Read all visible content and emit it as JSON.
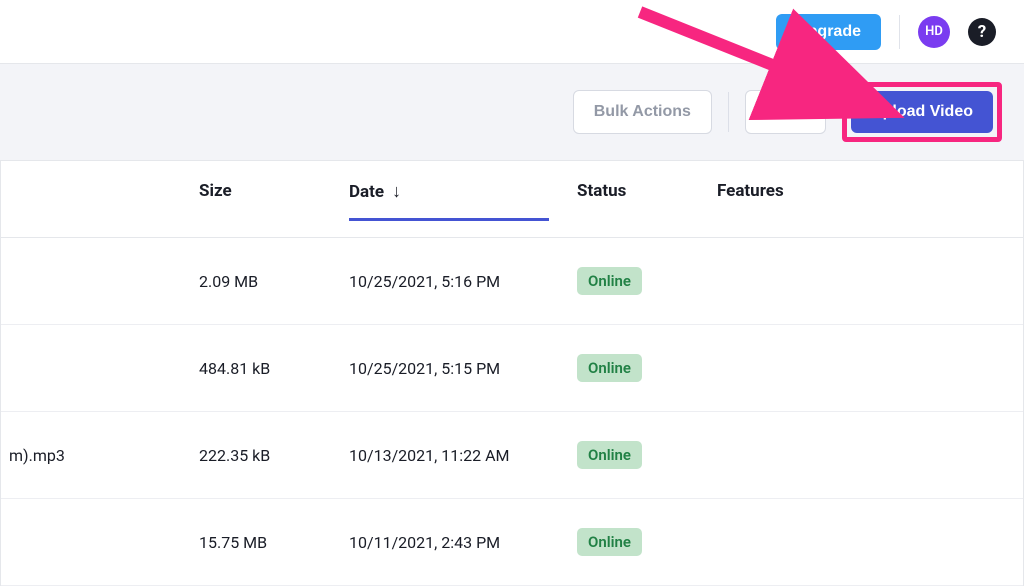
{
  "topbar": {
    "upgrade_label": "Upgrade",
    "avatar_initials": "HD",
    "help_glyph": "?"
  },
  "toolbar": {
    "bulk_actions_label": "Bulk Actions",
    "filter_label": "Filter",
    "upload_label": "Upload Video"
  },
  "table": {
    "headers": {
      "size": "Size",
      "date": "Date",
      "status": "Status",
      "features": "Features"
    },
    "rows": [
      {
        "name": "",
        "size": "2.09 MB",
        "date": "10/25/2021, 5:16 PM",
        "status": "Online"
      },
      {
        "name": "",
        "size": "484.81 kB",
        "date": "10/25/2021, 5:15 PM",
        "status": "Online"
      },
      {
        "name": "m).mp3",
        "size": "222.35 kB",
        "date": "10/13/2021, 11:22 AM",
        "status": "Online"
      },
      {
        "name": "",
        "size": "15.75 MB",
        "date": "10/11/2021, 2:43 PM",
        "status": "Online"
      }
    ]
  }
}
